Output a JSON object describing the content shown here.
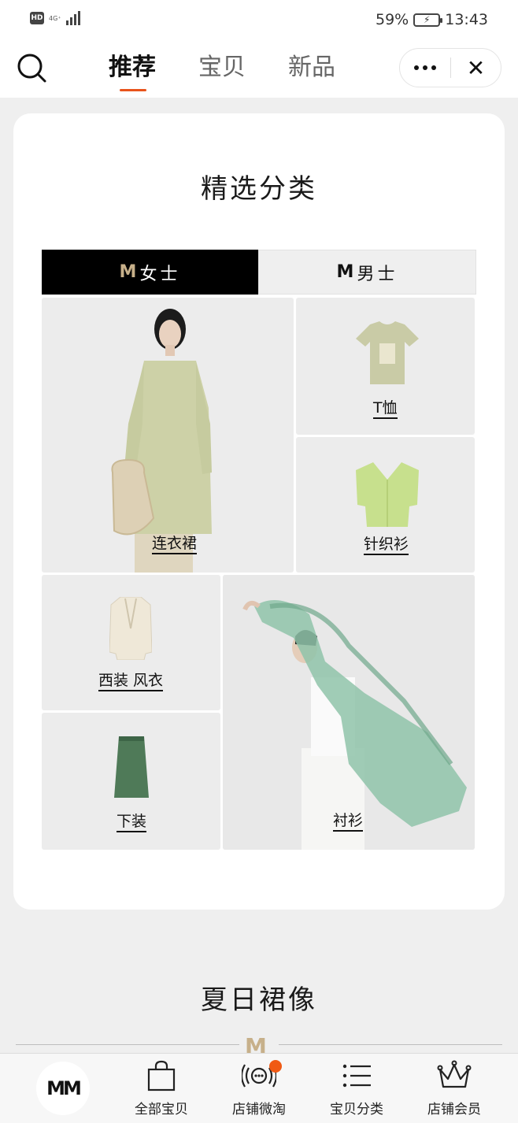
{
  "status_bar": {
    "hd": "HD",
    "network": "4G⁺",
    "battery_percent": "59%",
    "time": "13:43"
  },
  "top_nav": {
    "tabs": [
      {
        "label": "推荐",
        "active": true
      },
      {
        "label": "宝贝",
        "active": false
      },
      {
        "label": "新品",
        "active": false
      }
    ],
    "more_icon": "more-dots-icon",
    "close_icon": "close-icon"
  },
  "featured": {
    "title": "精选分类",
    "gender_tabs": [
      {
        "label": "女士",
        "active": true
      },
      {
        "label": "男士",
        "active": false
      }
    ],
    "categories": [
      {
        "label": "连衣裙"
      },
      {
        "label": "T恤"
      },
      {
        "label": "针织衫"
      },
      {
        "label": "西装 风衣"
      },
      {
        "label": "下装"
      },
      {
        "label": "衬衫"
      }
    ]
  },
  "summer": {
    "title": "夏日裙像"
  },
  "bottom_bar": {
    "home_logo": "MM",
    "items": [
      {
        "label": "全部宝贝",
        "icon": "shopping-bag-icon"
      },
      {
        "label": "店铺微淘",
        "icon": "broadcast-icon",
        "badge": true
      },
      {
        "label": "宝贝分类",
        "icon": "list-icon"
      },
      {
        "label": "店铺会员",
        "icon": "crown-icon"
      }
    ]
  },
  "colors": {
    "accent": "#e8541c",
    "gold": "#c7b08a",
    "badge": "#f05a14"
  }
}
